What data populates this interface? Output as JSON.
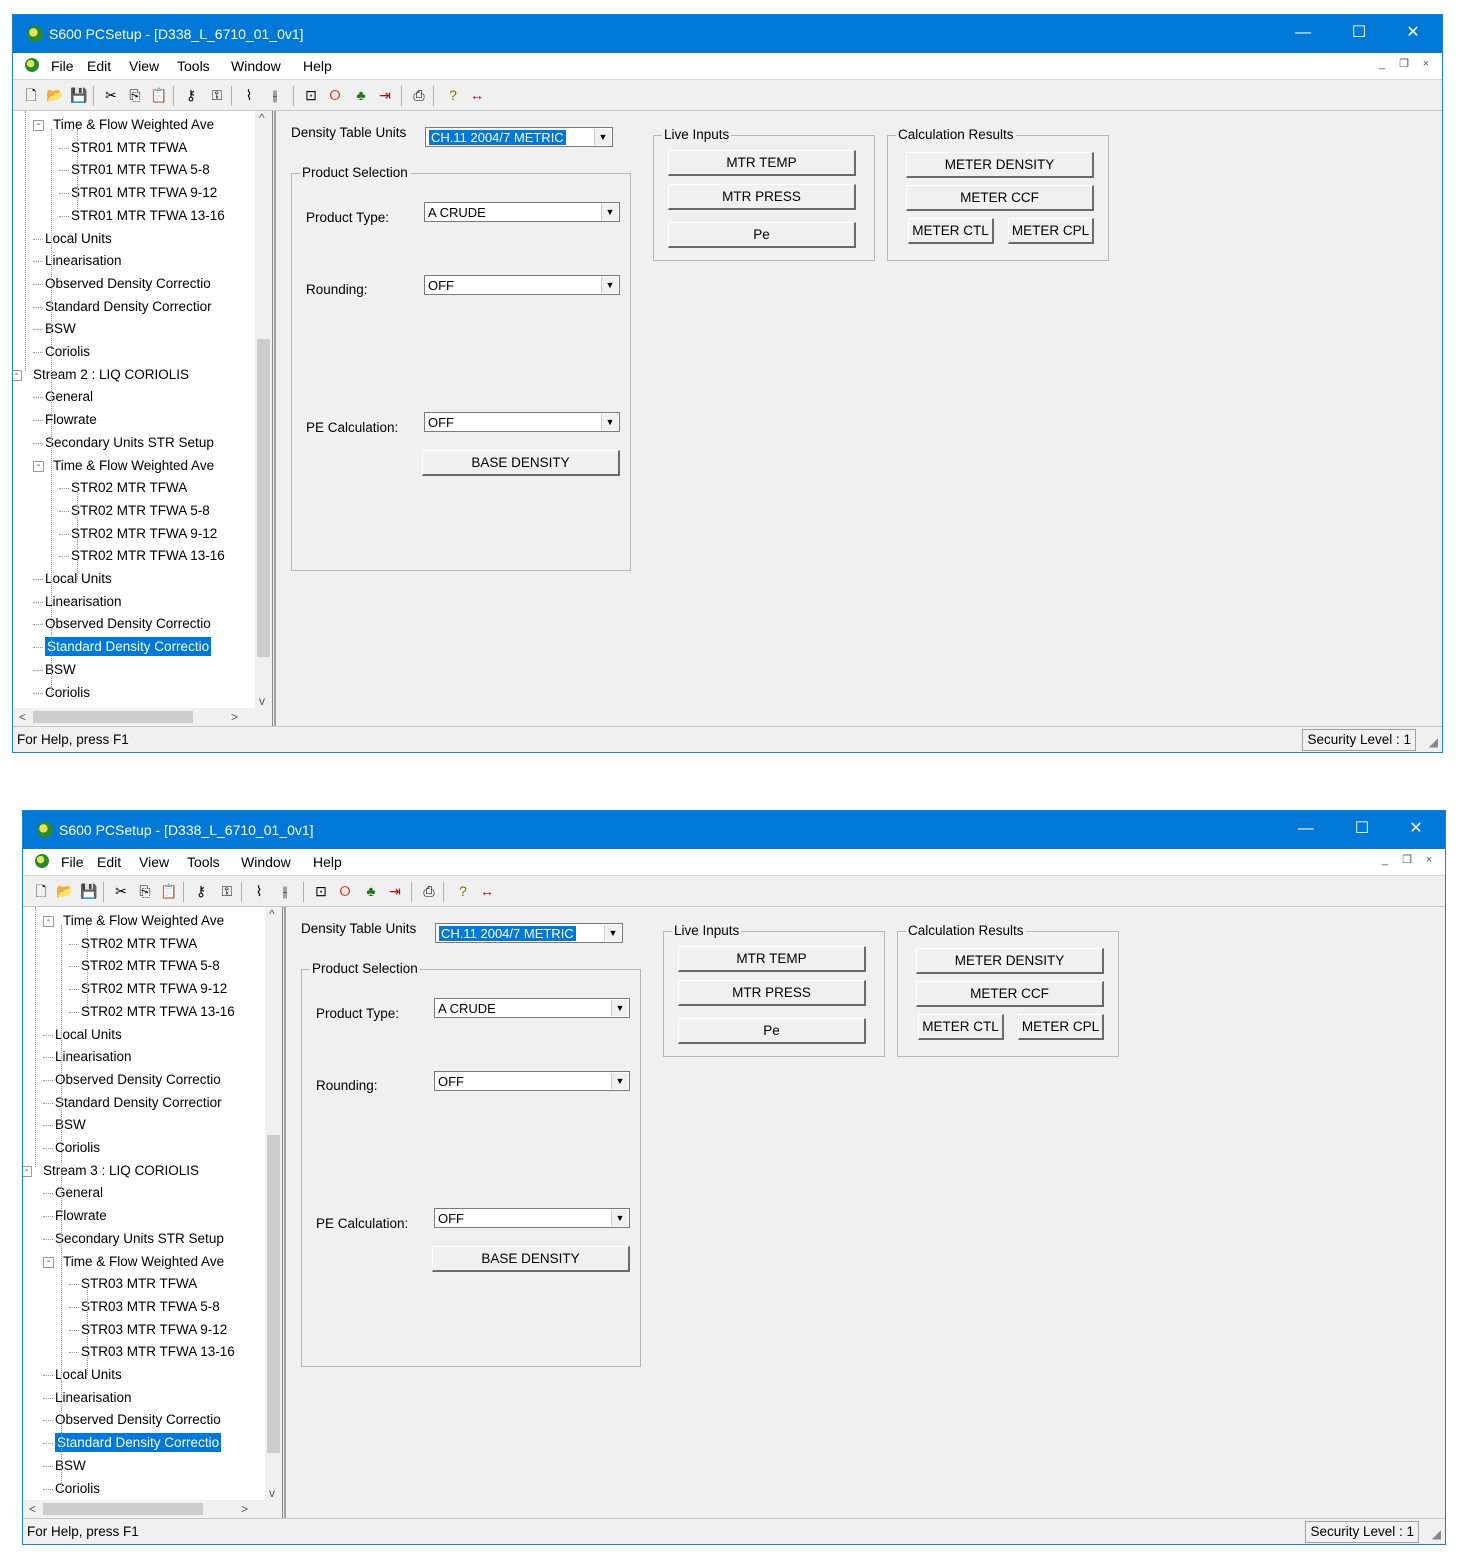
{
  "windows": [
    {
      "title": "S600 PCSetup - [D338_L_6710_01_0v1]",
      "controls": {
        "minimize": "—",
        "maximize": "☐",
        "close": "✕"
      },
      "menu": [
        "File",
        "Edit",
        "View",
        "Tools",
        "Window",
        "Help"
      ],
      "mdi_controls": {
        "minimize": "_",
        "restore": "❐",
        "close": "×"
      },
      "tree": [
        {
          "label": "Time & Flow Weighted Ave",
          "level": 1,
          "expander": "-",
          "selected": false
        },
        {
          "label": "STR01 MTR TFWA",
          "level": 2,
          "selected": false
        },
        {
          "label": "STR01 MTR TFWA 5-8",
          "level": 2,
          "selected": false
        },
        {
          "label": "STR01 MTR TFWA 9-12",
          "level": 2,
          "selected": false
        },
        {
          "label": "STR01 MTR TFWA 13-16",
          "level": 2,
          "selected": false
        },
        {
          "label": "Local Units",
          "level": 1,
          "selected": false
        },
        {
          "label": "Linearisation",
          "level": 1,
          "selected": false
        },
        {
          "label": "Observed Density Correctio",
          "level": 1,
          "selected": false
        },
        {
          "label": "Standard Density Correctior",
          "level": 1,
          "selected": false
        },
        {
          "label": "BSW",
          "level": 1,
          "selected": false
        },
        {
          "label": "Coriolis",
          "level": 1,
          "selected": false
        },
        {
          "label": "Stream 2 : LIQ CORIOLIS",
          "level": 0,
          "expander": "-",
          "selected": false
        },
        {
          "label": "General",
          "level": 1,
          "selected": false
        },
        {
          "label": "Flowrate",
          "level": 1,
          "selected": false
        },
        {
          "label": "Secondary Units STR Setup",
          "level": 1,
          "selected": false
        },
        {
          "label": "Time & Flow Weighted Ave",
          "level": 1,
          "expander": "-",
          "selected": false
        },
        {
          "label": "STR02 MTR TFWA",
          "level": 2,
          "selected": false
        },
        {
          "label": "STR02 MTR TFWA 5-8",
          "level": 2,
          "selected": false
        },
        {
          "label": "STR02 MTR TFWA 9-12",
          "level": 2,
          "selected": false
        },
        {
          "label": "STR02 MTR TFWA 13-16",
          "level": 2,
          "selected": false
        },
        {
          "label": "Local Units",
          "level": 1,
          "selected": false
        },
        {
          "label": "Linearisation",
          "level": 1,
          "selected": false
        },
        {
          "label": "Observed Density Correctio",
          "level": 1,
          "selected": false
        },
        {
          "label": "Standard Density Correctio",
          "level": 1,
          "selected": true
        },
        {
          "label": "BSW",
          "level": 1,
          "selected": false
        },
        {
          "label": "Coriolis",
          "level": 1,
          "selected": false
        }
      ],
      "tree_scroll_arrows": {
        "up": "^",
        "down": "v",
        "left": "<",
        "right": ">"
      },
      "form": {
        "density_table_units_label": "Density Table Units",
        "density_table_units_value": "CH.11 2004/7 METRIC",
        "product_selection_caption": "Product Selection",
        "product_type_label": "Product Type:",
        "product_type_value": "A CRUDE",
        "rounding_label": "Rounding:",
        "rounding_value": "OFF",
        "pe_calc_label": "PE Calculation:",
        "pe_calc_value": "OFF",
        "base_density_button": "BASE DENSITY",
        "live_inputs_caption": "Live Inputs",
        "live_inputs": [
          "MTR TEMP",
          "MTR PRESS",
          "Pe"
        ],
        "calc_results_caption": "Calculation Results",
        "calc_results": [
          "METER DENSITY",
          "METER CCF",
          "METER CTL",
          "METER CPL"
        ]
      },
      "status": {
        "help": "For Help, press F1",
        "security": "Security Level : 1"
      }
    },
    {
      "title": "S600 PCSetup - [D338_L_6710_01_0v1]",
      "controls": {
        "minimize": "—",
        "maximize": "☐",
        "close": "✕"
      },
      "menu": [
        "File",
        "Edit",
        "View",
        "Tools",
        "Window",
        "Help"
      ],
      "mdi_controls": {
        "minimize": "_",
        "restore": "❐",
        "close": "×"
      },
      "tree": [
        {
          "label": "Time & Flow Weighted Ave",
          "level": 1,
          "expander": "-",
          "selected": false
        },
        {
          "label": "STR02 MTR TFWA",
          "level": 2,
          "selected": false
        },
        {
          "label": "STR02 MTR TFWA 5-8",
          "level": 2,
          "selected": false
        },
        {
          "label": "STR02 MTR TFWA 9-12",
          "level": 2,
          "selected": false
        },
        {
          "label": "STR02 MTR TFWA 13-16",
          "level": 2,
          "selected": false
        },
        {
          "label": "Local Units",
          "level": 1,
          "selected": false
        },
        {
          "label": "Linearisation",
          "level": 1,
          "selected": false
        },
        {
          "label": "Observed Density Correctio",
          "level": 1,
          "selected": false
        },
        {
          "label": "Standard Density Correctior",
          "level": 1,
          "selected": false
        },
        {
          "label": "BSW",
          "level": 1,
          "selected": false
        },
        {
          "label": "Coriolis",
          "level": 1,
          "selected": false
        },
        {
          "label": "Stream 3 : LIQ CORIOLIS",
          "level": 0,
          "expander": "-",
          "selected": false
        },
        {
          "label": "General",
          "level": 1,
          "selected": false
        },
        {
          "label": "Flowrate",
          "level": 1,
          "selected": false
        },
        {
          "label": "Secondary Units STR Setup",
          "level": 1,
          "selected": false
        },
        {
          "label": "Time & Flow Weighted Ave",
          "level": 1,
          "expander": "-",
          "selected": false
        },
        {
          "label": "STR03 MTR TFWA",
          "level": 2,
          "selected": false
        },
        {
          "label": "STR03 MTR TFWA 5-8",
          "level": 2,
          "selected": false
        },
        {
          "label": "STR03 MTR TFWA 9-12",
          "level": 2,
          "selected": false
        },
        {
          "label": "STR03 MTR TFWA 13-16",
          "level": 2,
          "selected": false
        },
        {
          "label": "Local Units",
          "level": 1,
          "selected": false
        },
        {
          "label": "Linearisation",
          "level": 1,
          "selected": false
        },
        {
          "label": "Observed Density Correctio",
          "level": 1,
          "selected": false
        },
        {
          "label": "Standard Density Correctio",
          "level": 1,
          "selected": true
        },
        {
          "label": "BSW",
          "level": 1,
          "selected": false
        },
        {
          "label": "Coriolis",
          "level": 1,
          "selected": false
        }
      ],
      "tree_scroll_arrows": {
        "up": "^",
        "down": "v",
        "left": "<",
        "right": ">"
      },
      "form": {
        "density_table_units_label": "Density Table Units",
        "density_table_units_value": "CH.11 2004/7 METRIC",
        "product_selection_caption": "Product Selection",
        "product_type_label": "Product Type:",
        "product_type_value": "A CRUDE",
        "rounding_label": "Rounding:",
        "rounding_value": "OFF",
        "pe_calc_label": "PE Calculation:",
        "pe_calc_value": "OFF",
        "base_density_button": "BASE DENSITY",
        "live_inputs_caption": "Live Inputs",
        "live_inputs": [
          "MTR TEMP",
          "MTR PRESS",
          "Pe"
        ],
        "calc_results_caption": "Calculation Results",
        "calc_results": [
          "METER DENSITY",
          "METER CCF",
          "METER CTL",
          "METER CPL"
        ]
      },
      "status": {
        "help": "For Help, press F1",
        "security": "Security Level : 1"
      }
    }
  ],
  "toolbar_icons": [
    "new-icon",
    "open-icon",
    "save-icon",
    "cut-icon",
    "copy-icon",
    "paste-icon",
    "key-icon",
    "keys-icon",
    "connect-icon",
    "disconnect-icon",
    "plug-icon",
    "stop-icon",
    "tree-icon",
    "exit-icon",
    "print-icon",
    "help-icon",
    "arrow-icon"
  ],
  "colors": {
    "titlebar": "#0078d7",
    "selection": "#0078d7",
    "dialog_bg": "#f0f0f0"
  }
}
